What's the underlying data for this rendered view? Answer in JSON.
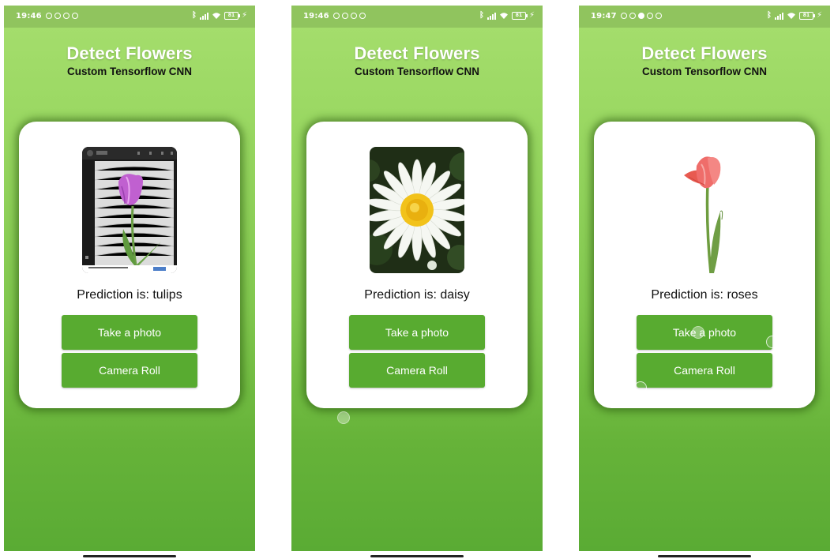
{
  "screens": [
    {
      "status_time": "19:46",
      "battery": "81",
      "title": "Detect Flowers",
      "subtitle": "Custom Tensorflow CNN",
      "image_icon": "tulip-screenshot-photo",
      "prediction": "Prediction is: tulips",
      "take_photo_label": "Take a photo",
      "camera_roll_label": "Camera Roll"
    },
    {
      "status_time": "19:46",
      "battery": "81",
      "title": "Detect Flowers",
      "subtitle": "Custom Tensorflow CNN",
      "image_icon": "daisy-photo",
      "prediction": "Prediction is: daisy",
      "take_photo_label": "Take a photo",
      "camera_roll_label": "Camera Roll"
    },
    {
      "status_time": "19:47",
      "battery": "81",
      "title": "Detect Flowers",
      "subtitle": "Custom Tensorflow CNN",
      "image_icon": "pink-tulip-photo",
      "prediction": "Prediction is: roses",
      "take_photo_label": "Take a photo",
      "camera_roll_label": "Camera Roll"
    }
  ],
  "colors": {
    "button": "#58ab30",
    "gradient_top": "#a6de6e",
    "gradient_bottom": "#5aab34",
    "card": "#ffffff"
  }
}
